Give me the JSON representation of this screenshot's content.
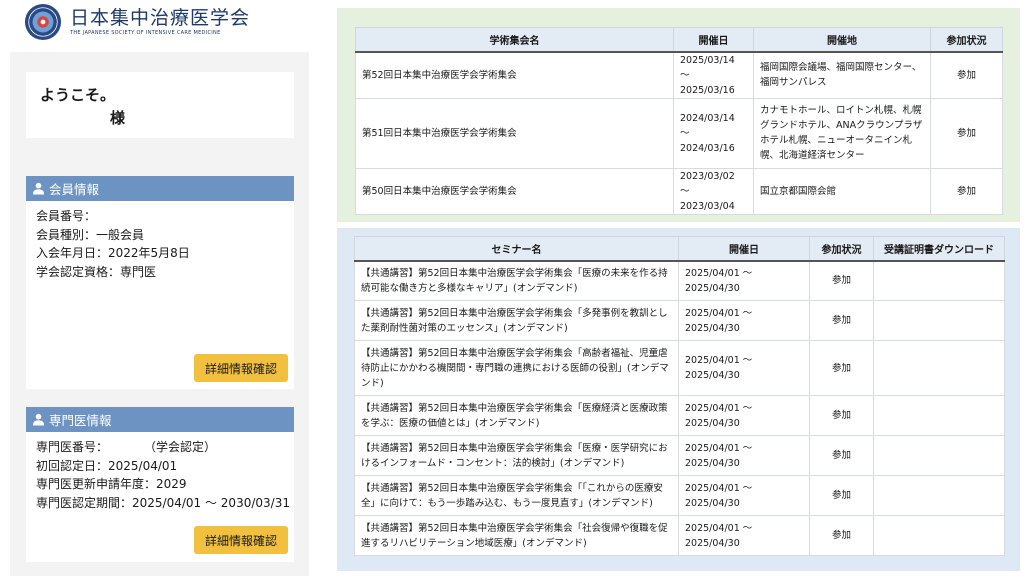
{
  "logo": {
    "name_jp": "日本集中治療医学会",
    "name_en": "THE JAPANESE SOCIETY OF INTENSIVE CARE MEDICINE"
  },
  "welcome": {
    "greeting": "ようこそ。",
    "honorific": "様"
  },
  "member_info": {
    "title": "会員情報",
    "number": "会員番号：",
    "type": "会員種別：一般会員",
    "joined": "入会年月日：2022年5月8日",
    "qualification": "学会認定資格：専門医",
    "button_label": "詳細情報確認"
  },
  "specialist_info": {
    "title": "専門医情報",
    "number": "専門医番号：　　　　（学会認定）",
    "first_cert": "初回認定日：2025/04/01",
    "renewal_year": "専門医更新申請年度：2029",
    "period": "専門医認定期間：2025/04/01 〜 2030/03/31",
    "button_label": "詳細情報確認"
  },
  "congress_table": {
    "headers": [
      "学術集会名",
      "開催日",
      "開催地",
      "参加状況"
    ],
    "rows": [
      {
        "name": "第52回日本集中治療医学会学術集会",
        "date": "2025/03/14 〜 2025/03/16",
        "venue": "福岡国際会議場、福岡国際センター、福岡サンパレス",
        "status": "参加"
      },
      {
        "name": "第51回日本集中治療医学会学術集会",
        "date": "2024/03/14 〜 2024/03/16",
        "venue": "カナモトホール、ロイトン札幌、札幌グランドホテル、ANAクラウンプラザホテル札幌、ニューオータニイン札幌、北海道経済センター",
        "status": "参加"
      },
      {
        "name": "第50回日本集中治療医学会学術集会",
        "date": "2023/03/02 〜 2023/03/04",
        "venue": "国立京都国際会館",
        "status": "参加"
      }
    ]
  },
  "seminar_table": {
    "headers": [
      "セミナー名",
      "開催日",
      "参加状況",
      "受講証明書ダウンロード"
    ],
    "rows": [
      {
        "name": "【共通講習】第52回日本集中治療医学会学術集会「医療の未来を作る持続可能な働き方と多様なキャリア」(オンデマンド)",
        "date": "2025/04/01 〜 2025/04/30",
        "status": "参加",
        "download": ""
      },
      {
        "name": "【共通講習】第52回日本集中治療医学会学術集会「多発事例を教訓とした薬剤耐性菌対策のエッセンス」(オンデマンド)",
        "date": "2025/04/01 〜 2025/04/30",
        "status": "参加",
        "download": ""
      },
      {
        "name": "【共通講習】第52回日本集中治療医学会学術集会「高齢者福祉、児童虐待防止にかかわる機関間・専門職の連携における医師の役割」(オンデマンド)",
        "date": "2025/04/01 〜 2025/04/30",
        "status": "参加",
        "download": ""
      },
      {
        "name": "【共通講習】第52回日本集中治療医学会学術集会「医療経済と医療政策を学ぶ：医療の価値とは」(オンデマンド)",
        "date": "2025/04/01 〜 2025/04/30",
        "status": "参加",
        "download": ""
      },
      {
        "name": "【共通講習】第52回日本集中治療医学会学術集会「医療・医学研究におけるインフォームド・コンセント：法的検討」(オンデマンド)",
        "date": "2025/04/01 〜 2025/04/30",
        "status": "参加",
        "download": ""
      },
      {
        "name": "【共通講習】第52回日本集中治療医学会学術集会「「これからの医療安全」に向けて：もう一歩踏み込む、もう一度見直す」(オンデマンド)",
        "date": "2025/04/01 〜 2025/04/30",
        "status": "参加",
        "download": ""
      },
      {
        "name": "【共通講習】第52回日本集中治療医学会学術集会「社会復帰や復職を促進するリハビリテーション地域医療」(オンデマンド)",
        "date": "2025/04/01 〜 2025/04/30",
        "status": "参加",
        "download": ""
      }
    ]
  },
  "colors": {
    "section_header": "#6d93c2",
    "detail_button": "#f1c03f",
    "congress_panel_bg": "#e6f0df",
    "seminar_panel_bg": "#dfe9f6"
  }
}
